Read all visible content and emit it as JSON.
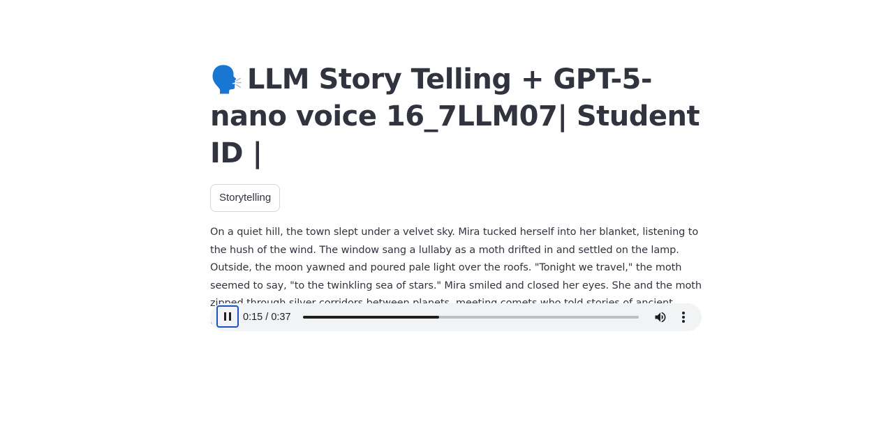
{
  "header": {
    "emoji": "🗣️",
    "title": "LLM Story Telling + GPT-5-nano voice 16_7LLM07| Student ID |"
  },
  "tag_button": {
    "label": "Storytelling"
  },
  "story": {
    "text": "On a quiet hill, the town slept under a velvet sky. Mira tucked herself into her blanket, listening to the hush of the wind. The window sang a lullaby as a moth drifted in and settled on the lamp. Outside, the moon yawned and poured pale light over the roofs. \"Tonight we travel,\" the moth seemed to say, \"to the twinkling sea of stars.\" Mira smiled and closed her eyes. She and the moth zipped through silver corridors between planets, meeting comets who told stories of ancient tapestries stitched by time. When morning whispered, Mira awoke with a sleepy heart."
  },
  "audio_player": {
    "state": "playing",
    "current_time": "0:15",
    "separator": "/",
    "duration": "0:37",
    "progress_fraction": 0.405,
    "icons": {
      "play_pause": "pause-icon",
      "volume": "volume-icon",
      "menu": "more-vert-icon"
    }
  }
}
